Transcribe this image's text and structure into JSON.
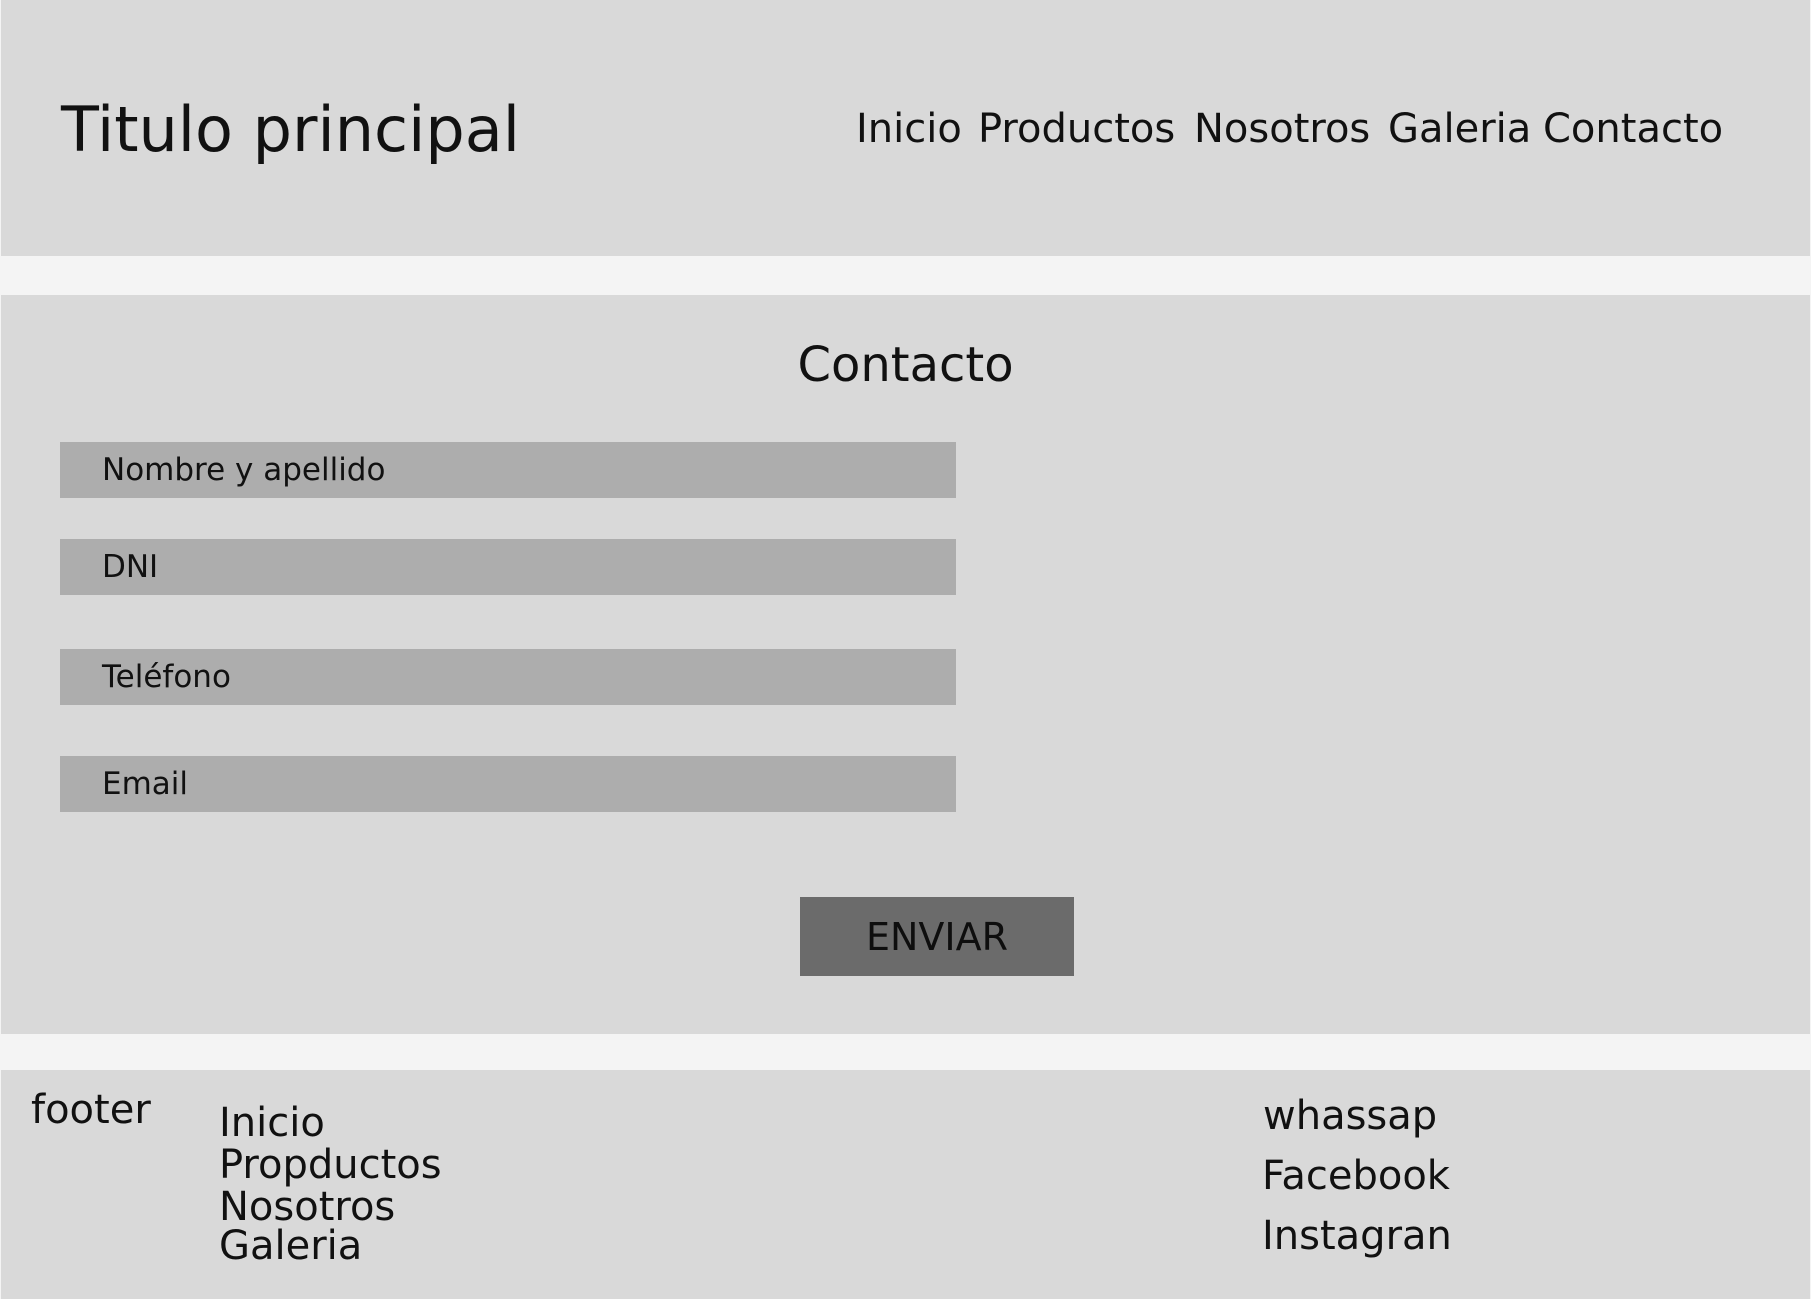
{
  "header": {
    "title": "Titulo principal",
    "nav": [
      "Inicio",
      "Productos",
      "Nosotros",
      "Galeria",
      "Contacto"
    ]
  },
  "contact": {
    "title": "Contacto",
    "fields": [
      "Nombre y apellido",
      "DNI",
      "Teléfono",
      "Email"
    ],
    "submit_label": "ENVIAR"
  },
  "footer": {
    "label": "footer",
    "links": [
      "Inicio",
      "Propductos",
      "Nosotros",
      "Galeria"
    ],
    "social": [
      "whassap",
      "Facebook",
      "Instagran"
    ]
  },
  "colors": {
    "panel_background": "#d9d9d9",
    "page_background": "#f4f4f4",
    "field_background": "#adadad",
    "button_background": "#6b6b6b"
  }
}
